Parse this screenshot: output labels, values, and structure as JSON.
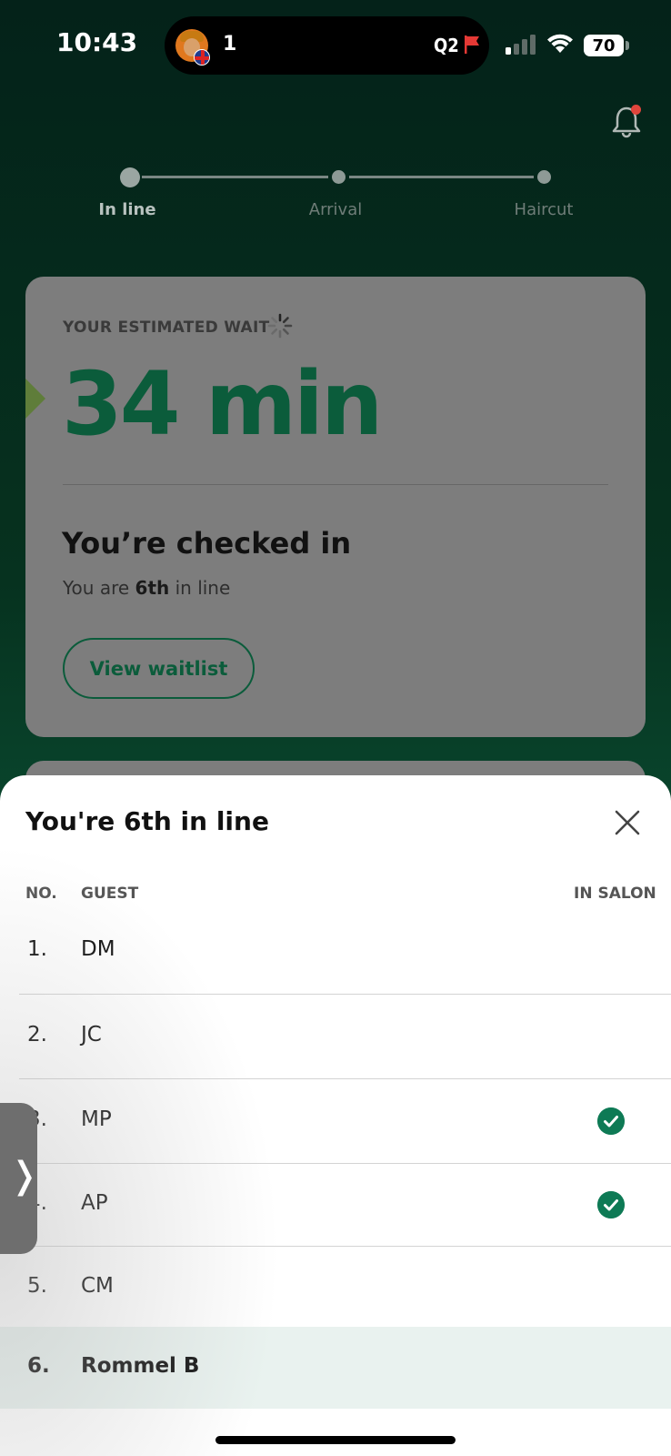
{
  "status_bar": {
    "time": "10:43",
    "island_count": "1",
    "island_label": "Q2",
    "battery": "70"
  },
  "progress": {
    "steps": [
      "In line",
      "Arrival",
      "Haircut"
    ],
    "active_index": 0
  },
  "wait_card": {
    "eyebrow": "YOUR ESTIMATED WAIT",
    "wait_value": "34 min",
    "checked_title": "You’re checked in",
    "position_prefix": "You are ",
    "position_value": "6th",
    "position_suffix": " in line",
    "view_button": "View waitlist"
  },
  "sheet": {
    "title": "You're 6th in line",
    "columns": {
      "no": "NO.",
      "guest": "GUEST",
      "in_salon": "IN SALON"
    },
    "rows": [
      {
        "no": "1.",
        "guest": "DM",
        "in_salon": false
      },
      {
        "no": "2.",
        "guest": "JC",
        "in_salon": false
      },
      {
        "no": "3.",
        "guest": "MP",
        "in_salon": true
      },
      {
        "no": "4.",
        "guest": "AP",
        "in_salon": true
      },
      {
        "no": "5.",
        "guest": "CM",
        "in_salon": false
      },
      {
        "no": "6.",
        "guest": "Rommel B",
        "in_salon": false,
        "is_you": true
      }
    ]
  },
  "colors": {
    "brand_green": "#0b5c3b",
    "check_green": "#0e7a55",
    "highlight_row": "#e9f2ef",
    "notification_dot": "#e0453c"
  }
}
